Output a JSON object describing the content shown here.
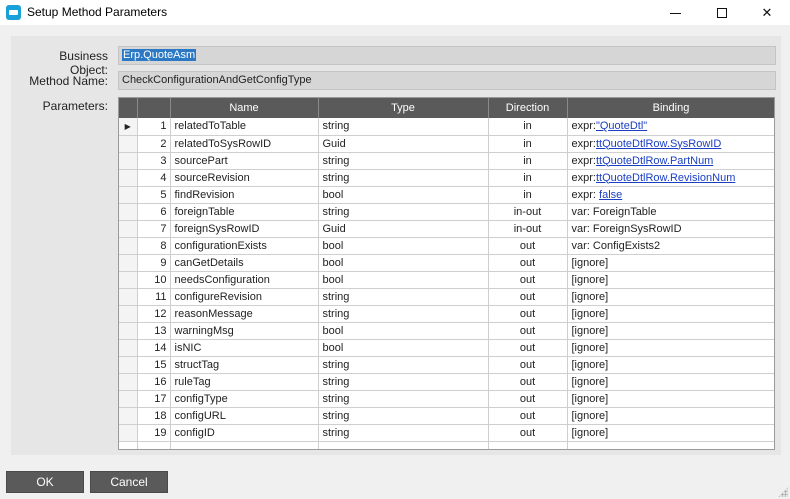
{
  "window": {
    "title": "Setup Method Parameters",
    "minimize_icon": "minimize-icon",
    "maximize_icon": "maximize-icon",
    "close_icon": "close-icon",
    "close_glyph": "✕"
  },
  "form": {
    "business_object_label": "Business Object:",
    "business_object_value": "Erp.QuoteAsm",
    "method_name_label": "Method Name:",
    "method_name_value": "CheckConfigurationAndGetConfigType",
    "parameters_label": "Parameters:"
  },
  "grid": {
    "columns": [
      "",
      "Name",
      "Type",
      "Direction",
      "Binding"
    ],
    "current_row_marker": "▶",
    "rows": [
      {
        "n": "1",
        "name": "relatedToTable",
        "type": "string",
        "dir": "in",
        "bind_prefix": "expr:",
        "bind_link": "\"QuoteDtl\"",
        "bind_text": ""
      },
      {
        "n": "2",
        "name": "relatedToSysRowID",
        "type": "Guid",
        "dir": "in",
        "bind_prefix": "expr:",
        "bind_link": "ttQuoteDtlRow.SysRowID",
        "bind_text": ""
      },
      {
        "n": "3",
        "name": "sourcePart",
        "type": "string",
        "dir": "in",
        "bind_prefix": "expr:",
        "bind_link": "ttQuoteDtlRow.PartNum",
        "bind_text": ""
      },
      {
        "n": "4",
        "name": "sourceRevision",
        "type": "string",
        "dir": "in",
        "bind_prefix": "expr:",
        "bind_link": "ttQuoteDtlRow.RevisionNum",
        "bind_text": ""
      },
      {
        "n": "5",
        "name": "findRevision",
        "type": "bool",
        "dir": "in",
        "bind_prefix": "expr: ",
        "bind_link": "false",
        "bind_text": ""
      },
      {
        "n": "6",
        "name": "foreignTable",
        "type": "string",
        "dir": "in-out",
        "bind_prefix": "",
        "bind_link": "",
        "bind_text": "var: ForeignTable"
      },
      {
        "n": "7",
        "name": "foreignSysRowID",
        "type": "Guid",
        "dir": "in-out",
        "bind_prefix": "",
        "bind_link": "",
        "bind_text": "var: ForeignSysRowID"
      },
      {
        "n": "8",
        "name": "configurationExists",
        "type": "bool",
        "dir": "out",
        "bind_prefix": "",
        "bind_link": "",
        "bind_text": "var: ConfigExists2"
      },
      {
        "n": "9",
        "name": "canGetDetails",
        "type": "bool",
        "dir": "out",
        "bind_prefix": "",
        "bind_link": "",
        "bind_text": "[ignore]"
      },
      {
        "n": "10",
        "name": "needsConfiguration",
        "type": "bool",
        "dir": "out",
        "bind_prefix": "",
        "bind_link": "",
        "bind_text": "[ignore]"
      },
      {
        "n": "11",
        "name": "configureRevision",
        "type": "string",
        "dir": "out",
        "bind_prefix": "",
        "bind_link": "",
        "bind_text": "[ignore]"
      },
      {
        "n": "12",
        "name": "reasonMessage",
        "type": "string",
        "dir": "out",
        "bind_prefix": "",
        "bind_link": "",
        "bind_text": "[ignore]"
      },
      {
        "n": "13",
        "name": "warningMsg",
        "type": "bool",
        "dir": "out",
        "bind_prefix": "",
        "bind_link": "",
        "bind_text": "[ignore]"
      },
      {
        "n": "14",
        "name": "isNIC",
        "type": "bool",
        "dir": "out",
        "bind_prefix": "",
        "bind_link": "",
        "bind_text": "[ignore]"
      },
      {
        "n": "15",
        "name": "structTag",
        "type": "string",
        "dir": "out",
        "bind_prefix": "",
        "bind_link": "",
        "bind_text": "[ignore]"
      },
      {
        "n": "16",
        "name": "ruleTag",
        "type": "string",
        "dir": "out",
        "bind_prefix": "",
        "bind_link": "",
        "bind_text": "[ignore]"
      },
      {
        "n": "17",
        "name": "configType",
        "type": "string",
        "dir": "out",
        "bind_prefix": "",
        "bind_link": "",
        "bind_text": "[ignore]"
      },
      {
        "n": "18",
        "name": "configURL",
        "type": "string",
        "dir": "out",
        "bind_prefix": "",
        "bind_link": "",
        "bind_text": "[ignore]"
      },
      {
        "n": "19",
        "name": "configID",
        "type": "string",
        "dir": "out",
        "bind_prefix": "",
        "bind_link": "",
        "bind_text": "[ignore]"
      }
    ]
  },
  "buttons": {
    "ok": "OK",
    "cancel": "Cancel"
  },
  "colors": {
    "header_bg": "#5a5a5a",
    "link": "#1a3fc4",
    "selection": "#2b78c5"
  }
}
